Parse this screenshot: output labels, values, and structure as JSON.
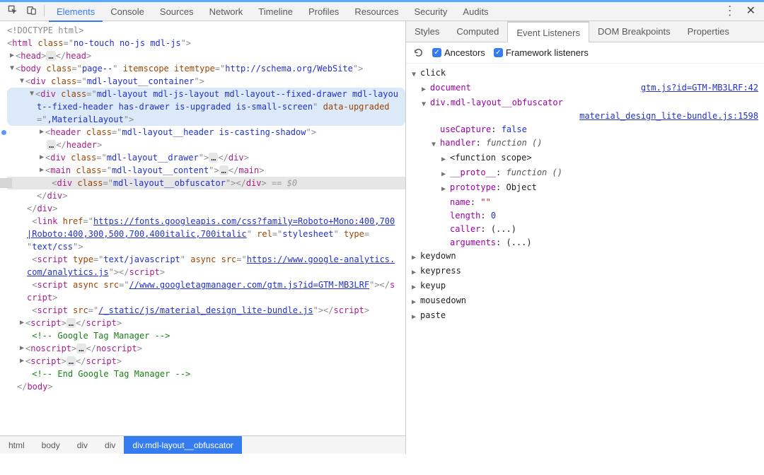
{
  "topbar": {
    "tabs": [
      "Elements",
      "Console",
      "Sources",
      "Network",
      "Timeline",
      "Profiles",
      "Resources",
      "Security",
      "Audits"
    ],
    "activeTab": "Elements"
  },
  "elements": {
    "doctype": "!DOCTYPE html",
    "htmlClass": "no-touch no-js mdl-js",
    "bodyClass": "page--",
    "bodyItemscope": "itemscope",
    "bodyItemtype": "http://schema.org/WebSite",
    "div1Class": "mdl-layout__container",
    "div2Class": "mdl-layout mdl-js-layout mdl-layout--fixed-drawer mdl-layout--fixed-header has-drawer is-upgraded is-small-screen",
    "div2Upgraded": ",MaterialLayout",
    "headerClass": "mdl-layout__header is-casting-shadow",
    "drawerClass": "mdl-layout__drawer",
    "mainClass": "mdl-layout__content",
    "obfClass": "mdl-layout__obfuscator",
    "selectedSuffix": " == $0",
    "linkHref": "https://fonts.googleapis.com/css?family=Roboto+Mono:400,700|Roboto:400,300,500,700,400italic,700italic",
    "linkRel": "stylesheet",
    "linkType": "text/css",
    "script1Type": "text/javascript",
    "script1Src": "https://www.google-analytics.com/analytics.js",
    "script2Src": "//www.googletagmanager.com/gtm.js?id=GTM-MB3LRF",
    "script3Src": "/_static/js/material_design_lite-bundle.js",
    "comment1": " Google Tag Manager ",
    "comment2": " End Google Tag Manager "
  },
  "crumbs": [
    "html",
    "body",
    "div",
    "div",
    "div.mdl-layout__obfuscator"
  ],
  "rightTabs": [
    "Styles",
    "Computed",
    "Event Listeners",
    "DOM Breakpoints",
    "Properties"
  ],
  "rightActive": "Event Listeners",
  "toolbar": {
    "ancestors": "Ancestors",
    "framework": "Framework listeners"
  },
  "events": {
    "click": "click",
    "document": "document",
    "docLink": "gtm.js?id=GTM-MB3LRF:42",
    "obf": "div.mdl-layout__obfuscator",
    "obfLink": "material_design_lite-bundle.js:1598",
    "useCapture": "useCapture",
    "useCaptureVal": "false",
    "handler": "handler",
    "handlerVal": "function ()",
    "funcScope": "<function scope>",
    "proto": "__proto__",
    "protoVal": "function ()",
    "prototype": "prototype",
    "prototypeVal": "Object",
    "nameK": "name",
    "nameV": "\"\"",
    "lengthK": "length",
    "lengthV": "0",
    "callerK": "caller",
    "callerV": "(...)",
    "argsK": "arguments",
    "argsV": "(...)",
    "rest": [
      "keydown",
      "keypress",
      "keyup",
      "mousedown",
      "paste"
    ]
  }
}
